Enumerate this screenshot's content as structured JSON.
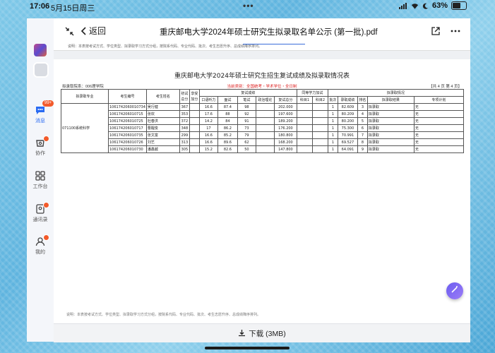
{
  "statusbar": {
    "time": "17:06",
    "date": "5月15日周三",
    "dots": "•••",
    "battery": "63%",
    "battery_level": 0.63
  },
  "sidebar": {
    "items": [
      {
        "label": "消息",
        "icon": "message-icon",
        "badge": "99+"
      },
      {
        "label": "协作",
        "icon": "collaborate-icon",
        "badge": "1"
      },
      {
        "label": "工作台",
        "icon": "workbench-icon",
        "badge": ""
      },
      {
        "label": "通讯录",
        "icon": "contacts-icon",
        "badge": "1"
      },
      {
        "label": "我的",
        "icon": "profile-icon",
        "badge": "1"
      }
    ]
  },
  "toolbar": {
    "back_label": "返回",
    "title": "重庆邮电大学2024年硕士研究生拟录取名单公示 (第一批).pdf"
  },
  "strip_text": "说明：本表按考试方式、学位类型、拟录取学习方式分组，按院系代码、专业代码、批次、考生志愿升序、总成绩降序排列。",
  "document": {
    "title": "重庆邮电大学2024年硕士研究生招生复试成绩及拟录取情况表",
    "college": "拟录取院系：006理学院",
    "category": "当前类别：全国统考・学术学位・全日制",
    "page_info": "【共 4 页 第 4 页】",
    "headers": {
      "major": "拟录取专业",
      "exam_no": "考生编号",
      "name": "考生姓名",
      "prelim": "初试总分",
      "disabled": "享受加分",
      "retest": "复试成绩",
      "equiv": "同等学力加试",
      "admit": "拟录取情况",
      "listening": "口语听力",
      "interview": "面试",
      "written": "笔试",
      "politics": "政治理论",
      "retest_total": "复试总分",
      "subj1": "科目1",
      "subj2": "科目2",
      "batch": "批次",
      "total": "录取成绩",
      "rank": "排名",
      "result": "拟录取结果",
      "plan": "专项计划"
    },
    "major_value": "071100系统科学",
    "rows": [
      {
        "exam_no": "10617420600​10734",
        "name": "吴行健",
        "prelim": "367",
        "listening": "16.6",
        "interview": "87.4",
        "written": "98",
        "retest_total": "202.000",
        "batch": "1",
        "total": "82.609",
        "rank": "3",
        "result": "拟录取",
        "plan": "无"
      },
      {
        "exam_no": "10617420601​0715",
        "name": "张欢",
        "prelim": "353",
        "listening": "17.6",
        "interview": "88",
        "written": "92",
        "retest_total": "197.600",
        "batch": "1",
        "total": "80.209",
        "rank": "4",
        "result": "拟录取",
        "plan": "无"
      },
      {
        "exam_no": "10617420601​0725",
        "name": "杜春洪",
        "prelim": "372",
        "listening": "14.2",
        "interview": "84",
        "written": "91",
        "retest_total": "189.200",
        "batch": "1",
        "total": "80.200",
        "rank": "5",
        "result": "拟录取",
        "plan": "无"
      },
      {
        "exam_no": "10617420601​0717",
        "name": "曹醒俊",
        "prelim": "348",
        "listening": "17",
        "interview": "86.2",
        "written": "73",
        "retest_total": "176.200",
        "batch": "1",
        "total": "75.300",
        "rank": "6",
        "result": "拟录取",
        "plan": "无"
      },
      {
        "exam_no": "10617420601​0735",
        "name": "张文富",
        "prelim": "299",
        "listening": "16.6",
        "interview": "85.2",
        "written": "79",
        "retest_total": "180.800",
        "batch": "1",
        "total": "70.991",
        "rank": "7",
        "result": "拟录取",
        "plan": "无"
      },
      {
        "exam_no": "10617420601​0726",
        "name": "刘艺",
        "prelim": "313",
        "listening": "16.6",
        "interview": "89.6",
        "written": "62",
        "retest_total": "168.200",
        "batch": "1",
        "total": "69.527",
        "rank": "8",
        "result": "拟录取",
        "plan": "无"
      },
      {
        "exam_no": "10617420601​0730",
        "name": "潘鑫越",
        "prelim": "305",
        "listening": "15.2",
        "interview": "82.6",
        "written": "50",
        "retest_total": "147.800",
        "batch": "1",
        "total": "64.091",
        "rank": "9",
        "result": "拟录取",
        "plan": "无"
      }
    ]
  },
  "bottom_strip_text": "说明：本表按考试方式、学位类型、拟录取学习方式分组，按院系代码、专业代码、批次、考生志愿升序、总成绩降序排列。",
  "download_label": "下载 (3MB)",
  "colors": {
    "accent": "#2a6bf2",
    "badge": "#f25a2b",
    "category_red": "#dd2222"
  }
}
